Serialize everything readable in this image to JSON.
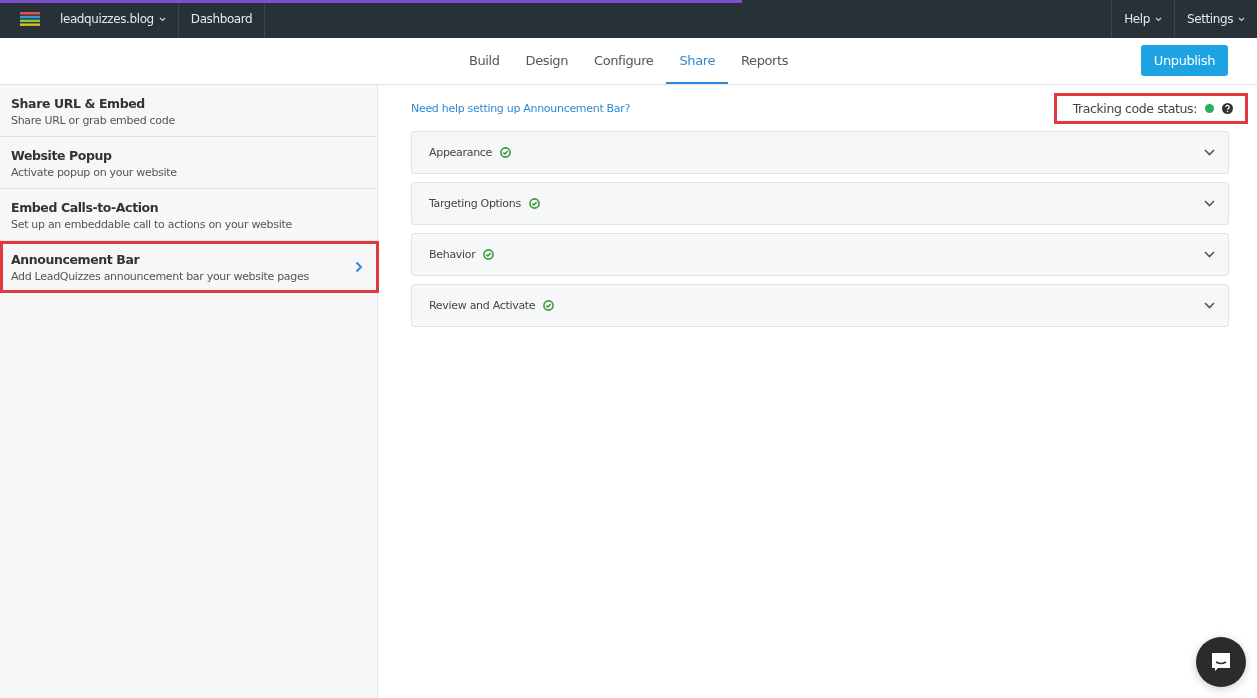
{
  "top_bar": {
    "progress": {
      "level": 0.59
    },
    "site_menu": {
      "label": "leadquizzes.blog"
    },
    "dashboard_link": {
      "label": "Dashboard"
    },
    "help_menu": {
      "label": "Help"
    },
    "settings_menu": {
      "label": "Settings"
    }
  },
  "tabs": [
    {
      "label": "Build",
      "selected": false
    },
    {
      "label": "Design",
      "selected": false
    },
    {
      "label": "Configure",
      "selected": false
    },
    {
      "label": "Share",
      "selected": true
    },
    {
      "label": "Reports",
      "selected": false
    }
  ],
  "unpublish_button": {
    "label": "Unpublish"
  },
  "sidebar": {
    "items": [
      {
        "title": "Share URL & Embed",
        "subtitle": "Share URL or grab embed code",
        "selected": false,
        "highlighted": false
      },
      {
        "title": "Website Popup",
        "subtitle": "Activate popup on your website",
        "selected": false,
        "highlighted": false
      },
      {
        "title": "Embed Calls-to-Action",
        "subtitle": "Set up an embeddable call to actions on your website",
        "selected": false,
        "highlighted": false
      },
      {
        "title": "Announcement Bar",
        "subtitle": "Add LeadQuizzes announcement bar your website pages",
        "selected": true,
        "highlighted": true
      }
    ]
  },
  "main": {
    "help_link": "Need help setting up Announcement Bar?",
    "tracking_status": {
      "label": "Tracking code status:",
      "color": "#27ae60",
      "highlighted": true
    },
    "sections": [
      {
        "title": "Appearance",
        "completed": true,
        "expanded": false
      },
      {
        "title": "Targeting Options",
        "completed": true,
        "expanded": false
      },
      {
        "title": "Behavior",
        "completed": true,
        "expanded": false
      },
      {
        "title": "Review and Activate",
        "completed": true,
        "expanded": false
      }
    ]
  }
}
